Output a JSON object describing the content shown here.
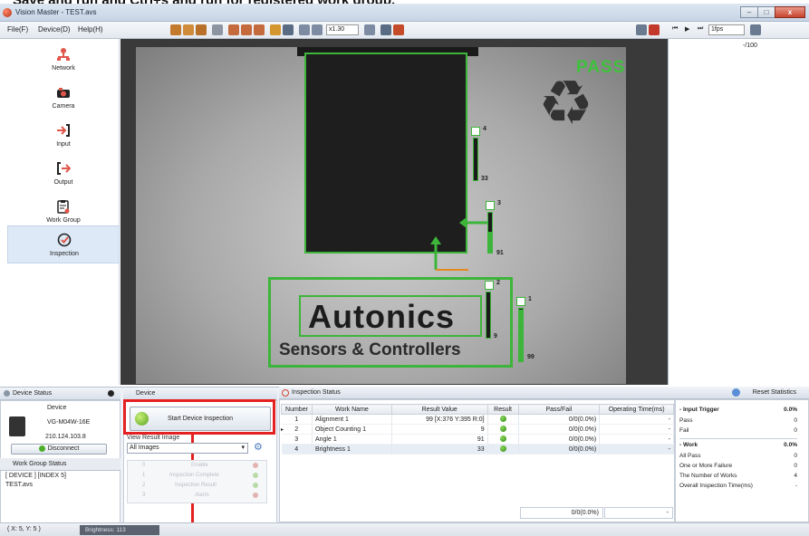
{
  "banner_text": "Save and run and Ctrl+s and run for registered work group.",
  "window": {
    "title": "Vision Master - TEST.avs",
    "minimize": "–",
    "maximize": "□",
    "close": "x"
  },
  "menu": [
    "File(F)",
    "Device(D)",
    "Help(H)"
  ],
  "toolbar": {
    "zoom": "x1.30",
    "fps": "1fps"
  },
  "sidebar": {
    "items": [
      {
        "label": "Network",
        "icon": "network-icon"
      },
      {
        "label": "Camera",
        "icon": "camera-icon"
      },
      {
        "label": "Input",
        "icon": "input-arrow-icon"
      },
      {
        "label": "Output",
        "icon": "output-arrow-icon"
      },
      {
        "label": "Work Group",
        "icon": "clipboard-icon"
      },
      {
        "label": "Inspection",
        "icon": "check-circle-icon"
      }
    ],
    "active": "Inspection"
  },
  "image_view": {
    "pass_label": "PASS",
    "logo_text": "Autonics",
    "logo_subtext": "Sensors & Controllers",
    "bars": [
      {
        "index": "4",
        "value": "33"
      },
      {
        "index": "3",
        "value": "91"
      },
      {
        "index": "2",
        "value": "9"
      },
      {
        "index": "1",
        "value": "99"
      }
    ]
  },
  "right_panel": {
    "counter": "-/100"
  },
  "device_status": {
    "header": "Device Status",
    "device_label": "Device",
    "model": "VG-M04W-16E",
    "ip": "210.124.103.8",
    "disconnect": "Disconnect"
  },
  "work_group_status": {
    "header": "Work Group Status",
    "line1": "[ DEVICE ] [INDEX 5]",
    "line2": "TEST.avs"
  },
  "device_panel": {
    "header": "Device",
    "start_button": "Start Device Inspection",
    "view_result_label": "View Result Image",
    "view_select": "All Images",
    "disabled_rows": [
      {
        "num": "0",
        "label": "Enable"
      },
      {
        "num": "1",
        "label": "Inspection Complete"
      },
      {
        "num": "2",
        "label": "Inspection Result"
      },
      {
        "num": "3",
        "label": "Alarm"
      }
    ]
  },
  "inspection_status": {
    "header": "Inspection Status",
    "columns": [
      "Number",
      "Work Name",
      "Result Value",
      "Result",
      "Pass/Fail",
      "Operating Time(ms)"
    ],
    "rows": [
      {
        "number": "1",
        "name": "Alignment 1",
        "value": "99 [X:376 Y:395 R:0]",
        "passfail": "0/0(0.0%)",
        "time": "-"
      },
      {
        "number": "2",
        "name": "Object Counting 1",
        "value": "9",
        "passfail": "0/0(0.0%)",
        "time": "-"
      },
      {
        "number": "3",
        "name": "Angle 1",
        "value": "91",
        "passfail": "0/0(0.0%)",
        "time": "-"
      },
      {
        "number": "4",
        "name": "Brightness 1",
        "value": "33",
        "passfail": "0/0(0.0%)",
        "time": "-"
      }
    ],
    "total_passfail": "0/0(0.0%)",
    "total_time": "-"
  },
  "statistics": {
    "reset_button": "Reset Statistics",
    "input_trigger": {
      "title": "- Input Trigger",
      "value": "0.0%",
      "pass_label": "Pass",
      "pass": "0",
      "fail_label": "Fail",
      "fail": "0"
    },
    "work": {
      "title": "- Work",
      "value": "0.0%",
      "all_pass_label": "All Pass",
      "all_pass": "0",
      "failure_label": "One or More Failure",
      "failure": "0",
      "works_label": "The Number of Works",
      "works": "4",
      "overall_label": "Overall Inspection Time(ms)",
      "overall": "-"
    }
  },
  "statusbar": {
    "coord": "( X:  5, Y:  5 )",
    "brightness": "Brightness: 113"
  }
}
